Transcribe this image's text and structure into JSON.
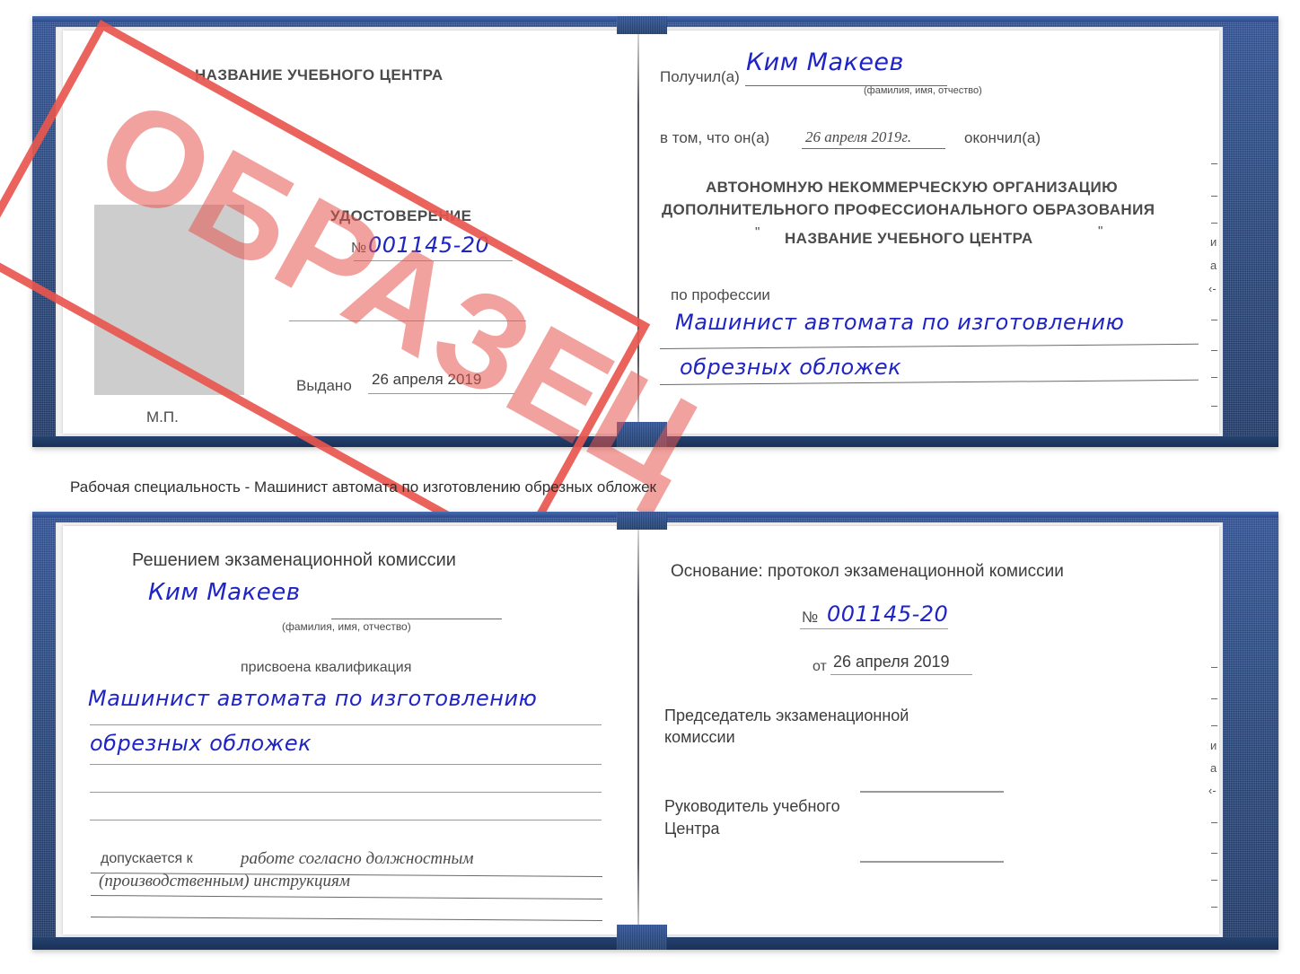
{
  "caption": {
    "text": "Рабочая специальность - Машинист автомата по изготовлению обрезных обложек"
  },
  "watermark": {
    "text": "ОБРАЗЕЦ",
    "color": "#e8564e"
  },
  "colors": {
    "cover_blue": "#2b4e8c",
    "handwriting_blue": "#1f24c4",
    "paper_white": "#ffffff",
    "rule_grey": "#9a9a9a",
    "photo_placeholder_grey": "#cdcdcd"
  },
  "certificate_top": {
    "left_page": {
      "org_title": "НАЗВАНИЕ УЧЕБНОГО ЦЕНТРА",
      "doc_type": "УДОСТОВЕРЕНИЕ",
      "number_symbol": "№",
      "number_value": "001145-20",
      "issued_label": "Выдано",
      "issued_value": "26 апреля 2019",
      "stamp_label": "М.П."
    },
    "right_page": {
      "received_label": "Получил(а)",
      "received_value": "Ким Макеев",
      "received_hint": "(фамилия, имя, отчество)",
      "in_that_label": "в том, что он(а)",
      "in_that_value": "26 апреля 2019г.",
      "finished_label": "окончил(а)",
      "org_line1": "АВТОНОМНУЮ НЕКОММЕРЧЕСКУЮ ОРГАНИЗАЦИЮ",
      "org_line2": "ДОПОЛНИТЕЛЬНОГО ПРОФЕССИОНАЛЬНОГО ОБРАЗОВАНИЯ",
      "org_quote_open": "\"",
      "org_line3": "НАЗВАНИЕ УЧЕБНОГО ЦЕНТРА",
      "org_quote_close": "\"",
      "profession_label": "по профессии",
      "profession_line1": "Машинист автомата по изготовлению",
      "profession_line2": "обрезных обложек",
      "edge_marks": [
        "–",
        "–",
        "–",
        "и",
        "а",
        "‹-",
        "–",
        "–",
        "–"
      ]
    }
  },
  "certificate_bottom": {
    "left_page": {
      "decision_title": "Решением экзаменационной комиссии",
      "name_value": "Ким Макеев",
      "name_hint": "(фамилия, имя, отчество)",
      "qualification_label": "присвоена квалификация",
      "qualification_line1": "Машинист автомата по изготовлению",
      "qualification_line2": "обрезных обложек",
      "allowed_label": "допускается к",
      "allowed_value_line1": "работе согласно должностным",
      "allowed_value_line2": "(производственным) инструкциям"
    },
    "right_page": {
      "basis_label": "Основание: протокол экзаменационной комиссии",
      "number_symbol": "№",
      "number_value": "001145-20",
      "date_label": "от",
      "date_value": "26 апреля 2019",
      "chair_line1": "Председатель экзаменационной",
      "chair_line2": "комиссии",
      "head_line1": "Руководитель учебного",
      "head_line2": "Центра",
      "edge_marks": [
        "–",
        "–",
        "–",
        "и",
        "а",
        "‹-",
        "–",
        "–",
        "–"
      ]
    }
  }
}
